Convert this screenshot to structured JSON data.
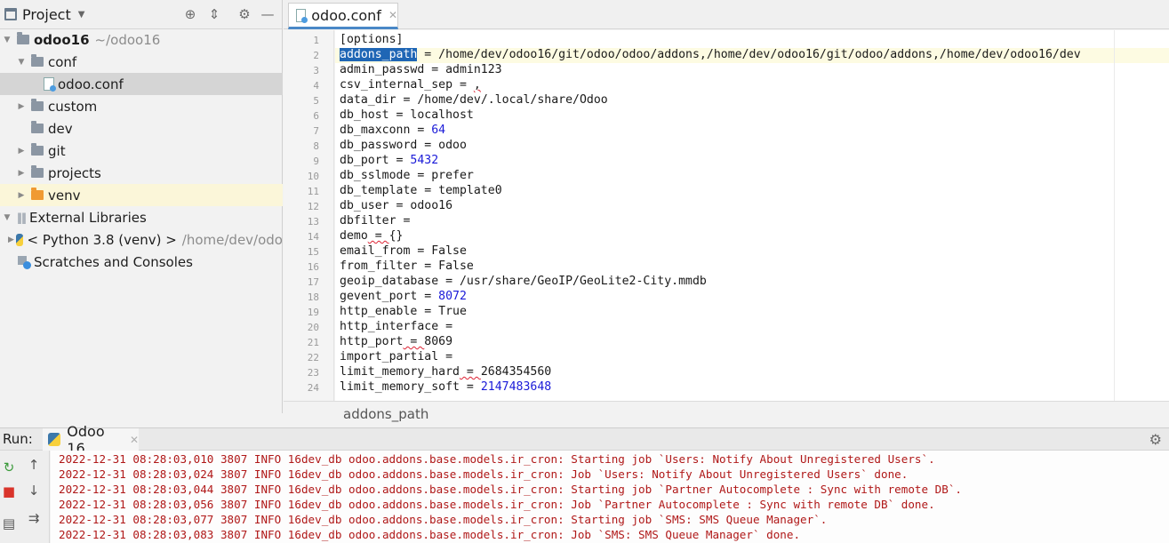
{
  "project_panel": {
    "title": "Project",
    "tree": [
      {
        "name": "odoo16",
        "path": "~/odoo16",
        "bold": true,
        "expanded": true,
        "depth": 0,
        "icon": "folder"
      },
      {
        "name": "conf",
        "expanded": true,
        "depth": 1,
        "icon": "folder"
      },
      {
        "name": "odoo.conf",
        "depth": 2,
        "icon": "config-file",
        "selected": true
      },
      {
        "name": "custom",
        "expanded": false,
        "depth": 1,
        "icon": "folder"
      },
      {
        "name": "dev",
        "depth": 1,
        "icon": "folder"
      },
      {
        "name": "git",
        "expanded": false,
        "depth": 1,
        "icon": "folder"
      },
      {
        "name": "projects",
        "expanded": false,
        "depth": 1,
        "icon": "folder"
      },
      {
        "name": "venv",
        "expanded": false,
        "depth": 1,
        "icon": "folder-orange"
      },
      {
        "name": "External Libraries",
        "expanded": true,
        "depth": 0,
        "icon": "libraries"
      },
      {
        "name": "< Python 3.8 (venv) >",
        "path": "/home/dev/odo",
        "expanded": false,
        "depth": 1,
        "icon": "python"
      },
      {
        "name": "Scratches and Consoles",
        "depth": 0,
        "icon": "scratches"
      }
    ]
  },
  "editor": {
    "tab_label": "odoo.conf",
    "breadcrumb": "addons_path",
    "lines": [
      {
        "n": "1",
        "key": "[options]",
        "eq": "",
        "val": ""
      },
      {
        "n": "2",
        "key": "addons_path",
        "eq": " = ",
        "val": "/home/dev/odoo16/git/odoo/odoo/addons,/home/dev/odoo16/git/odoo/addons,/home/dev/odoo16/dev"
      },
      {
        "n": "3",
        "key": "admin_passwd",
        "eq": " = ",
        "val": "admin123"
      },
      {
        "n": "4",
        "key": "csv_internal_sep",
        "eq": " = ",
        "val": ","
      },
      {
        "n": "5",
        "key": "data_dir",
        "eq": " = ",
        "val": "/home/dev/.local/share/Odoo"
      },
      {
        "n": "6",
        "key": "db_host",
        "eq": " = ",
        "val": "localhost"
      },
      {
        "n": "7",
        "key": "db_maxconn",
        "eq": " = ",
        "val": "64"
      },
      {
        "n": "8",
        "key": "db_password",
        "eq": " = ",
        "val": "odoo"
      },
      {
        "n": "9",
        "key": "db_port",
        "eq": " = ",
        "val": "5432"
      },
      {
        "n": "10",
        "key": "db_sslmode",
        "eq": " = ",
        "val": "prefer"
      },
      {
        "n": "11",
        "key": "db_template",
        "eq": " = ",
        "val": "template0"
      },
      {
        "n": "12",
        "key": "db_user",
        "eq": " = ",
        "val": "odoo16"
      },
      {
        "n": "13",
        "key": "dbfilter",
        "eq": " =",
        "val": ""
      },
      {
        "n": "14",
        "key": "demo",
        "eq": " = ",
        "val": "{}"
      },
      {
        "n": "15",
        "key": "email_from",
        "eq": " = ",
        "val": "False"
      },
      {
        "n": "16",
        "key": "from_filter",
        "eq": " = ",
        "val": "False"
      },
      {
        "n": "17",
        "key": "geoip_database",
        "eq": " = ",
        "val": "/usr/share/GeoIP/GeoLite2-City.mmdb"
      },
      {
        "n": "18",
        "key": "gevent_port",
        "eq": " = ",
        "val": "8072"
      },
      {
        "n": "19",
        "key": "http_enable",
        "eq": " = ",
        "val": "True"
      },
      {
        "n": "20",
        "key": "http_interface",
        "eq": " =",
        "val": ""
      },
      {
        "n": "21",
        "key": "http_port",
        "eq": " = ",
        "val": "8069"
      },
      {
        "n": "22",
        "key": "import_partial",
        "eq": " =",
        "val": ""
      },
      {
        "n": "23",
        "key": "limit_memory_hard",
        "eq": " = ",
        "val": "2684354560"
      },
      {
        "n": "24",
        "key": "limit_memory_soft",
        "eq": " = ",
        "val": "2147483648"
      }
    ]
  },
  "run_panel": {
    "label": "Run:",
    "tab_label": "Odoo 16",
    "log": [
      "2022-12-31 08:28:03,010 3807 INFO 16dev_db odoo.addons.base.models.ir_cron: Starting job `Users: Notify About Unregistered Users`.",
      "2022-12-31 08:28:03,024 3807 INFO 16dev_db odoo.addons.base.models.ir_cron: Job `Users: Notify About Unregistered Users` done.",
      "2022-12-31 08:28:03,044 3807 INFO 16dev_db odoo.addons.base.models.ir_cron: Starting job `Partner Autocomplete : Sync with remote DB`.",
      "2022-12-31 08:28:03,056 3807 INFO 16dev_db odoo.addons.base.models.ir_cron: Job `Partner Autocomplete : Sync with remote DB` done.",
      "2022-12-31 08:28:03,077 3807 INFO 16dev_db odoo.addons.base.models.ir_cron: Starting job `SMS: SMS Queue Manager`.",
      "2022-12-31 08:28:03,083 3807 INFO 16dev_db odoo.addons.base.models.ir_cron: Job `SMS: SMS Queue Manager` done."
    ]
  },
  "colors": {
    "log_text": "#b01818",
    "number": "#1a1ad8",
    "selection": "#1f66b5",
    "venv_folder": "#f09a32"
  }
}
